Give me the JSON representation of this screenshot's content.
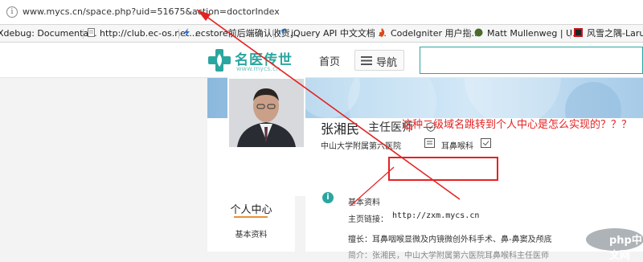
{
  "browser": {
    "url": "www.mycs.cn/space.php?uid=51675&action=doctorIndex",
    "bookmarks": [
      {
        "label": "Xdebug: Documenta...",
        "icon": "none"
      },
      {
        "label": "http://club.ec-os.net...",
        "icon": "page-icon"
      },
      {
        "label": "ecstore前后端确认收货...",
        "icon": "ecstore-icon"
      },
      {
        "label": "jQuery API 中文文档 ...",
        "icon": "jquery-icon"
      },
      {
        "label": "CodeIgniter 用户指...",
        "icon": "codeigniter-icon"
      },
      {
        "label": "Matt Mullenweg | U...",
        "icon": "circle-icon"
      },
      {
        "label": "风雪之隅-Laruen",
        "icon": "laruence-icon"
      }
    ]
  },
  "site": {
    "logo_text": "名医传世",
    "logo_sub": "www.mycs.cn",
    "nav_home": "首页",
    "nav_guide": "导航"
  },
  "doctor": {
    "name": "张湘民",
    "title": "主任医师",
    "hospital": "中山大学附属第六医院",
    "dept": "耳鼻喉科"
  },
  "sidebar": {
    "title": "个人中心",
    "item": "基本资料"
  },
  "content": {
    "section": "基本资料",
    "home_label": "主页链接：",
    "home_link": "http://zxm.mycs.cn",
    "good_at": "擅长：耳鼻咽喉显微及内镜微创外科手术、鼻-鼻窦及颅底",
    "bio_cut": "简介：张湘民，中山大学附属第六医院耳鼻喉科主任医师"
  },
  "annotation": {
    "text": "这种二级域名跳转到个人中心是怎么实现的？？？",
    "color": "#e52222"
  },
  "watermark": {
    "text": "php中文网"
  },
  "colors": {
    "accent": "#2aa6a0",
    "side_underline": "#e7913a"
  }
}
